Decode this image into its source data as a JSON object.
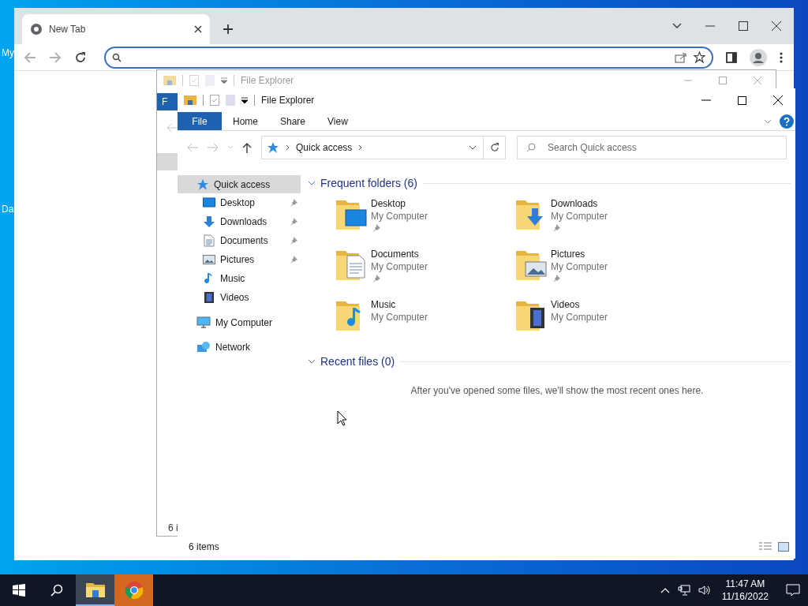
{
  "desktop": {
    "icon_labels": [
      "My",
      "Da"
    ]
  },
  "browser": {
    "tabs": [
      {
        "label": "New Tab",
        "selected": true
      }
    ]
  },
  "ghost_explorer": {
    "title": "File Explorer",
    "ribbon_tab": "F",
    "status": "6 i"
  },
  "explorer": {
    "title": "File Explorer",
    "ribbon_tabs": [
      {
        "label": "File",
        "selected": true
      },
      {
        "label": "Home",
        "selected": false
      },
      {
        "label": "Share",
        "selected": false
      },
      {
        "label": "View",
        "selected": false
      }
    ],
    "breadcrumb": [
      "Quick access"
    ],
    "search": {
      "placeholder": "Search Quick access"
    },
    "nav": [
      {
        "label": "Quick access",
        "kind": "star",
        "selected": true,
        "children": [
          {
            "label": "Desktop",
            "kind": "desktop",
            "selected": false,
            "pinned": true
          },
          {
            "label": "Downloads",
            "kind": "downloads",
            "selected": false,
            "pinned": true
          },
          {
            "label": "Documents",
            "kind": "documents",
            "selected": false,
            "pinned": true
          },
          {
            "label": "Pictures",
            "kind": "pictures",
            "selected": false,
            "pinned": true
          },
          {
            "label": "Music",
            "kind": "music",
            "selected": false,
            "pinned": false
          },
          {
            "label": "Videos",
            "kind": "videos",
            "selected": false,
            "pinned": false
          }
        ]
      },
      {
        "label": "My Computer",
        "kind": "computer",
        "selected": false
      },
      {
        "label": "Network",
        "kind": "network",
        "selected": false
      }
    ],
    "frequent": {
      "title": "Frequent folders (6)",
      "expanded": true,
      "folders": [
        {
          "name": "Desktop",
          "location": "My Computer",
          "kind": "desktop",
          "pinned": true
        },
        {
          "name": "Downloads",
          "location": "My Computer",
          "kind": "downloads",
          "pinned": true
        },
        {
          "name": "Documents",
          "location": "My Computer",
          "kind": "documents",
          "pinned": true
        },
        {
          "name": "Pictures",
          "location": "My Computer",
          "kind": "pictures",
          "pinned": true
        },
        {
          "name": "Music",
          "location": "My Computer",
          "kind": "music",
          "pinned": false
        },
        {
          "name": "Videos",
          "location": "My Computer",
          "kind": "videos",
          "pinned": false
        }
      ]
    },
    "recent": {
      "title": "Recent files (0)",
      "expanded": true,
      "empty_message": "After you've opened some files, we'll show the most recent ones here."
    },
    "status": "6 items"
  },
  "taskbar": {
    "apps": [
      {
        "kind": "explorer",
        "selected": true,
        "flashing": false
      },
      {
        "kind": "chrome",
        "selected": false,
        "flashing": true
      }
    ],
    "time": "11:47 AM",
    "date": "11/16/2022"
  }
}
